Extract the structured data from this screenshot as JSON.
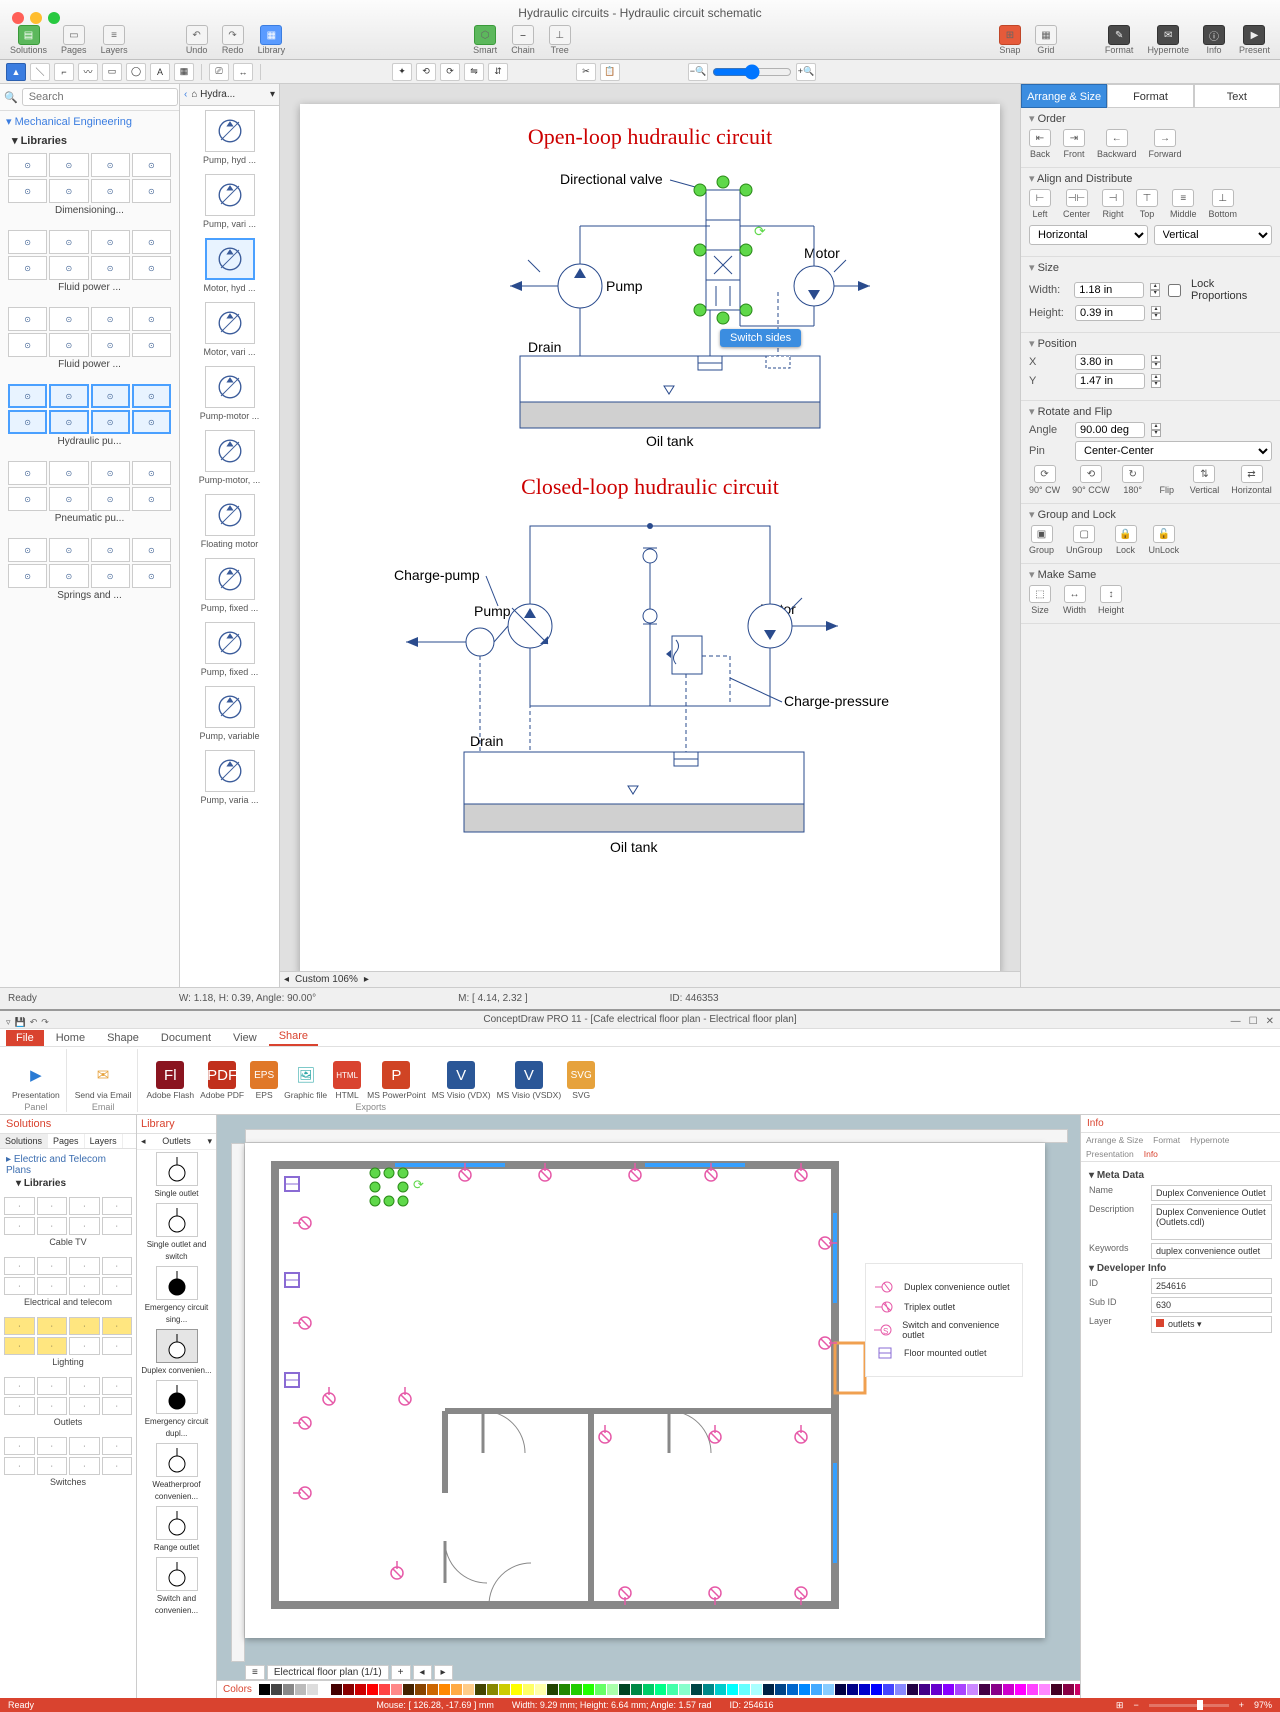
{
  "app1": {
    "window_title": "Hydraulic circuits - Hydraulic circuit schematic",
    "toolbar_groups": {
      "solutions": "Solutions",
      "pages": "Pages",
      "layers": "Layers",
      "undo": "Undo",
      "redo": "Redo",
      "library": "Library",
      "smart": "Smart",
      "chain": "Chain",
      "tree": "Tree",
      "snap": "Snap",
      "grid": "Grid",
      "format": "Format",
      "hypernote": "Hypernote",
      "info": "Info",
      "present": "Present"
    },
    "search_placeholder": "Search",
    "sidebar": {
      "category": "Mechanical Engineering",
      "subhead": "Libraries",
      "groups": [
        "Dimensioning...",
        "Fluid power ...",
        "Fluid power ...",
        "Hydraulic pu...",
        "Pneumatic pu...",
        "Springs and ..."
      ]
    },
    "shape_strip": {
      "crumb": "Hydra...",
      "items": [
        "Pump, hyd ...",
        "Pump, vari ...",
        "Motor, hyd ...",
        "Motor, vari ...",
        "Pump-motor ...",
        "Pump-motor, ...",
        "Floating motor",
        "Pump, fixed ...",
        "Pump, fixed ...",
        "Pump, variable",
        "Pump, varia ..."
      ]
    },
    "canvas": {
      "title1": "Open-loop hudraulic circuit",
      "title2": "Closed-loop hudraulic circuit",
      "labels": {
        "dir_valve": "Directional valve",
        "pump": "Pump",
        "motor": "Motor",
        "drain": "Drain",
        "oil_tank": "Oil tank",
        "charge_pump": "Charge-pump",
        "charge_pressure": "Charge-pressure"
      },
      "tooltip": "Switch sides",
      "zoom_label": "Custom 106%"
    },
    "right": {
      "tabs": [
        "Arrange & Size",
        "Format",
        "Text"
      ],
      "order": {
        "h": "Order",
        "back": "Back",
        "front": "Front",
        "backward": "Backward",
        "forward": "Forward"
      },
      "align": {
        "h": "Align and Distribute",
        "left": "Left",
        "center": "Center",
        "right": "Right",
        "top": "Top",
        "middle": "Middle",
        "bottom": "Bottom",
        "horiz": "Horizontal",
        "vert": "Vertical"
      },
      "size": {
        "h": "Size",
        "w_lbl": "Width:",
        "w": "1.18 in",
        "h_lbl": "Height:",
        "hv": "0.39 in",
        "lock": "Lock Proportions"
      },
      "pos": {
        "h": "Position",
        "x_lbl": "X",
        "x": "3.80 in",
        "y_lbl": "Y",
        "y": "1.47 in"
      },
      "rotate": {
        "h": "Rotate and Flip",
        "angle_lbl": "Angle",
        "angle": "90.00 deg",
        "pin_lbl": "Pin",
        "pin": "Center-Center",
        "cw": "90° CW",
        "ccw": "90° CCW",
        "r180": "180°",
        "flip": "Flip",
        "vert": "Vertical",
        "horiz": "Horizontal"
      },
      "group": {
        "h": "Group and Lock",
        "group": "Group",
        "ungroup": "UnGroup",
        "lock": "Lock",
        "unlock": "UnLock"
      },
      "same": {
        "h": "Make Same",
        "size": "Size",
        "width": "Width",
        "height": "Height"
      }
    },
    "status": {
      "ready": "Ready",
      "wh": "W: 1.18,  H: 0.39,  Angle: 90.00°",
      "mouse": "M: [ 4.14, 2.32 ]",
      "id": "ID: 446353"
    }
  },
  "app2": {
    "window_title": "ConceptDraw PRO 11 - [Cafe electrical floor plan - Electrical floor plan]",
    "ribbon_tabs": [
      "File",
      "Home",
      "Shape",
      "Document",
      "View",
      "Share"
    ],
    "ribbon": {
      "panel": "Panel",
      "email": "Email",
      "exports": "Exports",
      "presentation": "Presentation",
      "send_email": "Send via Email",
      "flash": "Adobe Flash",
      "pdf": "Adobe PDF",
      "eps": "EPS",
      "graphic": "Graphic file",
      "html": "HTML",
      "ppt": "MS PowerPoint",
      "vdx": "MS Visio (VDX)",
      "vsdx": "MS Visio (VSDX)",
      "svg": "SVG"
    },
    "solutions": {
      "title": "Solutions",
      "tabs": [
        "Solutions",
        "Pages",
        "Layers"
      ],
      "tree_root": "Electric and Telecom Plans",
      "tree_lib": "Libraries",
      "groups": [
        "Cable TV",
        "Electrical and telecom",
        "Lighting",
        "Outlets",
        "Switches"
      ]
    },
    "library": {
      "title": "Library",
      "dropdown": "Outlets",
      "items": [
        "Single outlet",
        "Single outlet and switch",
        "Emergency circuit sing...",
        "Duplex convenien...",
        "Emergency circuit dupl...",
        "Weatherproof convenien...",
        "Range outlet",
        "Switch and convenien..."
      ]
    },
    "legend": {
      "duplex": "Duplex convenience outlet",
      "triplex": "Triplex outlet",
      "switch": "Switch and convenience outlet",
      "floor": "Floor mounted outlet"
    },
    "page_tab": "Electrical floor plan (1/1)",
    "colors_label": "Colors",
    "info": {
      "title": "Info",
      "tabs": [
        "Arrange & Size",
        "Format",
        "Hypernote",
        "Presentation",
        "Info"
      ],
      "meta_h": "Meta Data",
      "name_lbl": "Name",
      "name": "Duplex Convenience Outlet",
      "desc_lbl": "Description",
      "desc": "Duplex Convenience Outlet (Outlets.cdl)",
      "kw_lbl": "Keywords",
      "kw": "duplex convenience outlet",
      "dev_h": "Developer Info",
      "id_lbl": "ID",
      "id": "254616",
      "sub_lbl": "Sub ID",
      "sub": "630",
      "layer_lbl": "Layer",
      "layer": "outlets"
    },
    "status": {
      "ready": "Ready",
      "mouse": "Mouse: [ 126.28, -17.69 ] mm",
      "dims": "Width: 9.29 mm;   Height: 6.64 mm;   Angle: 1.57 rad",
      "id": "ID: 254616",
      "zoom": "97%"
    }
  }
}
